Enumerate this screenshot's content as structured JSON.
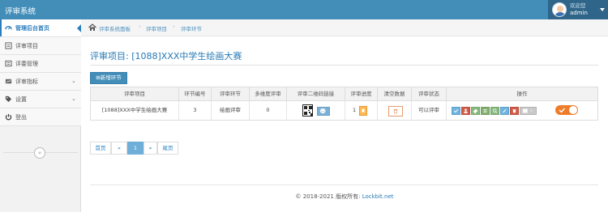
{
  "app": {
    "title": "评审系统"
  },
  "user": {
    "welcome": "欢迎您",
    "name": "admin"
  },
  "sidebar": {
    "items": [
      {
        "label": "管理后台首页",
        "icon": "dashboard-icon"
      },
      {
        "label": "评审项目",
        "icon": "list-icon"
      },
      {
        "label": "评委管理",
        "icon": "user-list-icon"
      },
      {
        "label": "评审指标",
        "icon": "chart-icon"
      },
      {
        "label": "设置",
        "icon": "tag-icon"
      },
      {
        "label": "登出",
        "icon": "power-icon"
      }
    ],
    "collapse_label": "«"
  },
  "breadcrumb": {
    "items": [
      "评审系统面板",
      "评审项目",
      "评审环节"
    ],
    "separator": "›"
  },
  "page": {
    "title": "评审项目: [1088]XXX中学生绘画大赛",
    "add_button": "新增环节"
  },
  "table": {
    "headers": [
      "评审项目",
      "环节编号",
      "评审环节",
      "多维度评审",
      "评审二维码链接",
      "评审进度",
      "清空数据",
      "评审状态",
      "操作"
    ],
    "rows": [
      {
        "project": "[1088]XXX中学生绘画大赛",
        "number": "3",
        "stage": "绘画评审",
        "multi_dim": "0",
        "progress": "1",
        "status": "可以评审"
      }
    ]
  },
  "pagination": {
    "first": "首页",
    "prev": "«",
    "current": "1",
    "next": "»",
    "last": "尾页"
  },
  "footer": {
    "copyright": "© 2018-2021 版权所有: ",
    "link": "Lockbit.net"
  },
  "colors": {
    "topbar": "#438eb9",
    "accent": "#2b7dbc",
    "title": "#2679b5",
    "toggle": "#ee7c28"
  }
}
